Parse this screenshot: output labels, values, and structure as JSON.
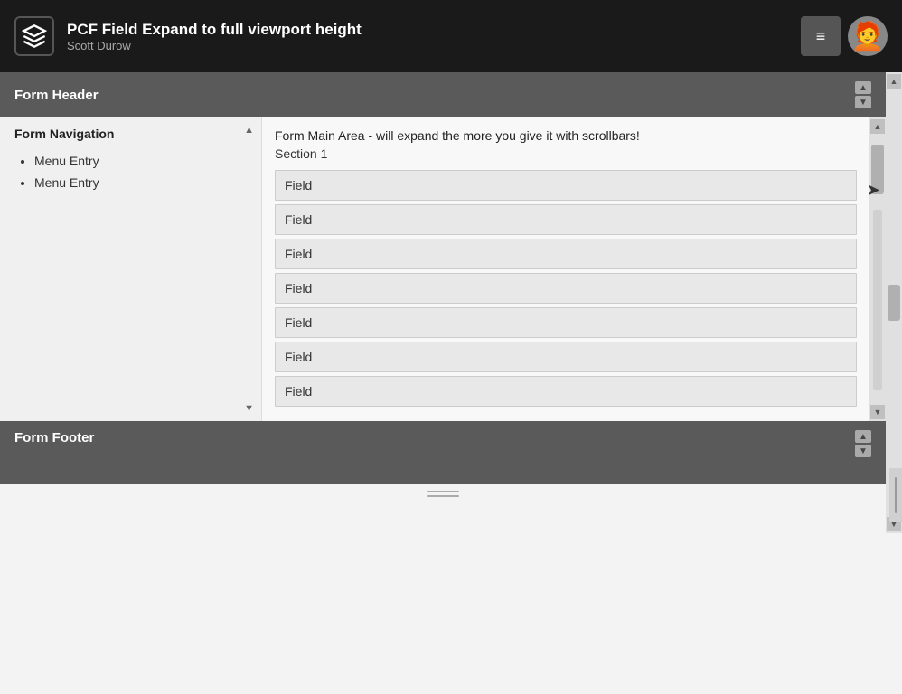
{
  "topbar": {
    "title": "PCF Field Expand to full viewport height",
    "subtitle": "Scott Durow",
    "logo_icon": "cube-icon",
    "menu_icon": "≡",
    "avatar_initial": "👤"
  },
  "form_header": {
    "label": "Form Header"
  },
  "form_nav": {
    "label": "Form Navigation",
    "menu_items": [
      {
        "label": "Menu Entry"
      },
      {
        "label": "Menu Entry"
      }
    ]
  },
  "form_main": {
    "title": "Form Main Area - will expand the more you give it with scrollbars!",
    "section": "Section 1",
    "fields": [
      {
        "label": "Field"
      },
      {
        "label": "Field"
      },
      {
        "label": "Field"
      },
      {
        "label": "Field"
      },
      {
        "label": "Field"
      },
      {
        "label": "Field"
      },
      {
        "label": "Field"
      }
    ]
  },
  "form_footer": {
    "label": "Form Footer"
  },
  "scrollbar": {
    "up_arrow": "▲",
    "down_arrow": "▼",
    "left_arrow": "◀",
    "right_arrow": "▶"
  },
  "resize_handle": {
    "lines": 2
  }
}
